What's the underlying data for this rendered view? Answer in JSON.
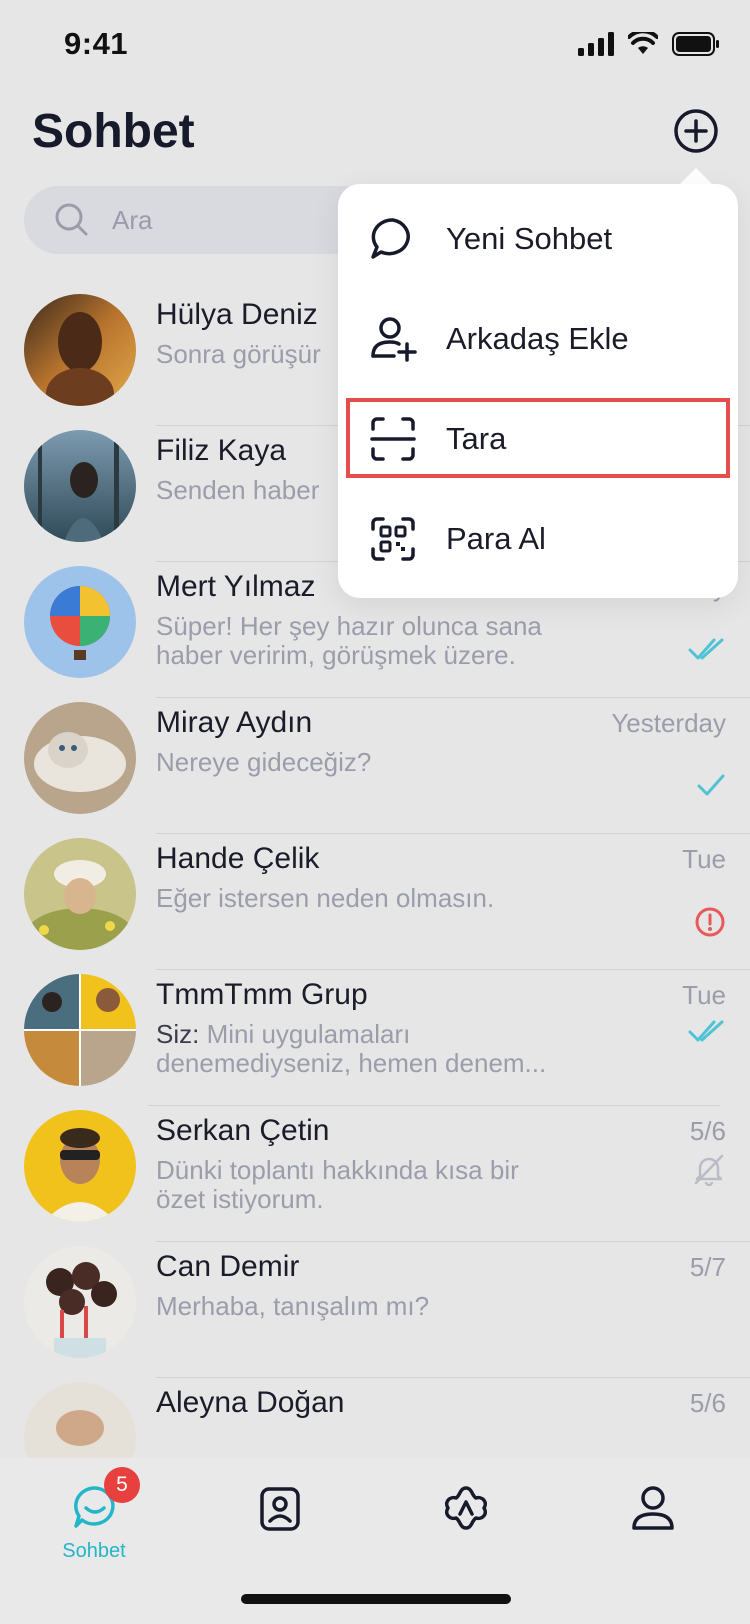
{
  "status": {
    "time": "9:41"
  },
  "header": {
    "title": "Sohbet"
  },
  "search": {
    "placeholder": "Ara"
  },
  "chats": [
    {
      "name": "Hülya Deniz",
      "message": "Sonra görüşür",
      "time": "",
      "status": "none"
    },
    {
      "name": "Filiz Kaya",
      "message": "Senden haber",
      "time": "",
      "status": "none"
    },
    {
      "name": "Mert Yılmaz",
      "message": "Süper! Her şey hazır olunca sana\nhaber veririm, görüşmek üzere.",
      "time": "Yesterday",
      "status": "double-check"
    },
    {
      "name": "Miray Aydın",
      "message": "Nereye gideceğiz?",
      "time": "Yesterday",
      "status": "single-check"
    },
    {
      "name": "Hande Çelik",
      "message": "Eğer istersen neden olmasın.",
      "time": "Tue",
      "status": "error"
    },
    {
      "name": "TmmTmm Grup",
      "sender": "Siz:",
      "message": " Mini uygulamaları\ndenemediyseniz, hemen denem...",
      "time": "Tue",
      "status": "double-check"
    },
    {
      "name": "Serkan Çetin",
      "message": "Dünki toplantı hakkında kısa bir\nözet istiyorum.",
      "time": "5/6",
      "status": "muted"
    },
    {
      "name": "Can Demir",
      "message": "Merhaba, tanışalım mı?",
      "time": "5/7",
      "status": "none"
    },
    {
      "name": "Aleyna Doğan",
      "message": "",
      "time": "5/6",
      "status": "none"
    }
  ],
  "menu": {
    "items": [
      {
        "label": "Yeni Sohbet",
        "icon": "chat-bubble-icon"
      },
      {
        "label": "Arkadaş Ekle",
        "icon": "add-user-icon"
      },
      {
        "label": "Tara",
        "icon": "scan-icon"
      },
      {
        "label": "Para Al",
        "icon": "qr-code-icon"
      }
    ]
  },
  "tabbar": {
    "items": [
      {
        "label": "Sohbet",
        "icon": "chat-icon",
        "badge": "5",
        "active": true
      },
      {
        "label": "",
        "icon": "contacts-icon"
      },
      {
        "label": "",
        "icon": "discover-icon"
      },
      {
        "label": "",
        "icon": "profile-icon"
      }
    ]
  },
  "colors": {
    "accent": "#23b6c9",
    "badge": "#e8403f",
    "error": "#e85a5a",
    "highlight": "#e74c4c"
  }
}
